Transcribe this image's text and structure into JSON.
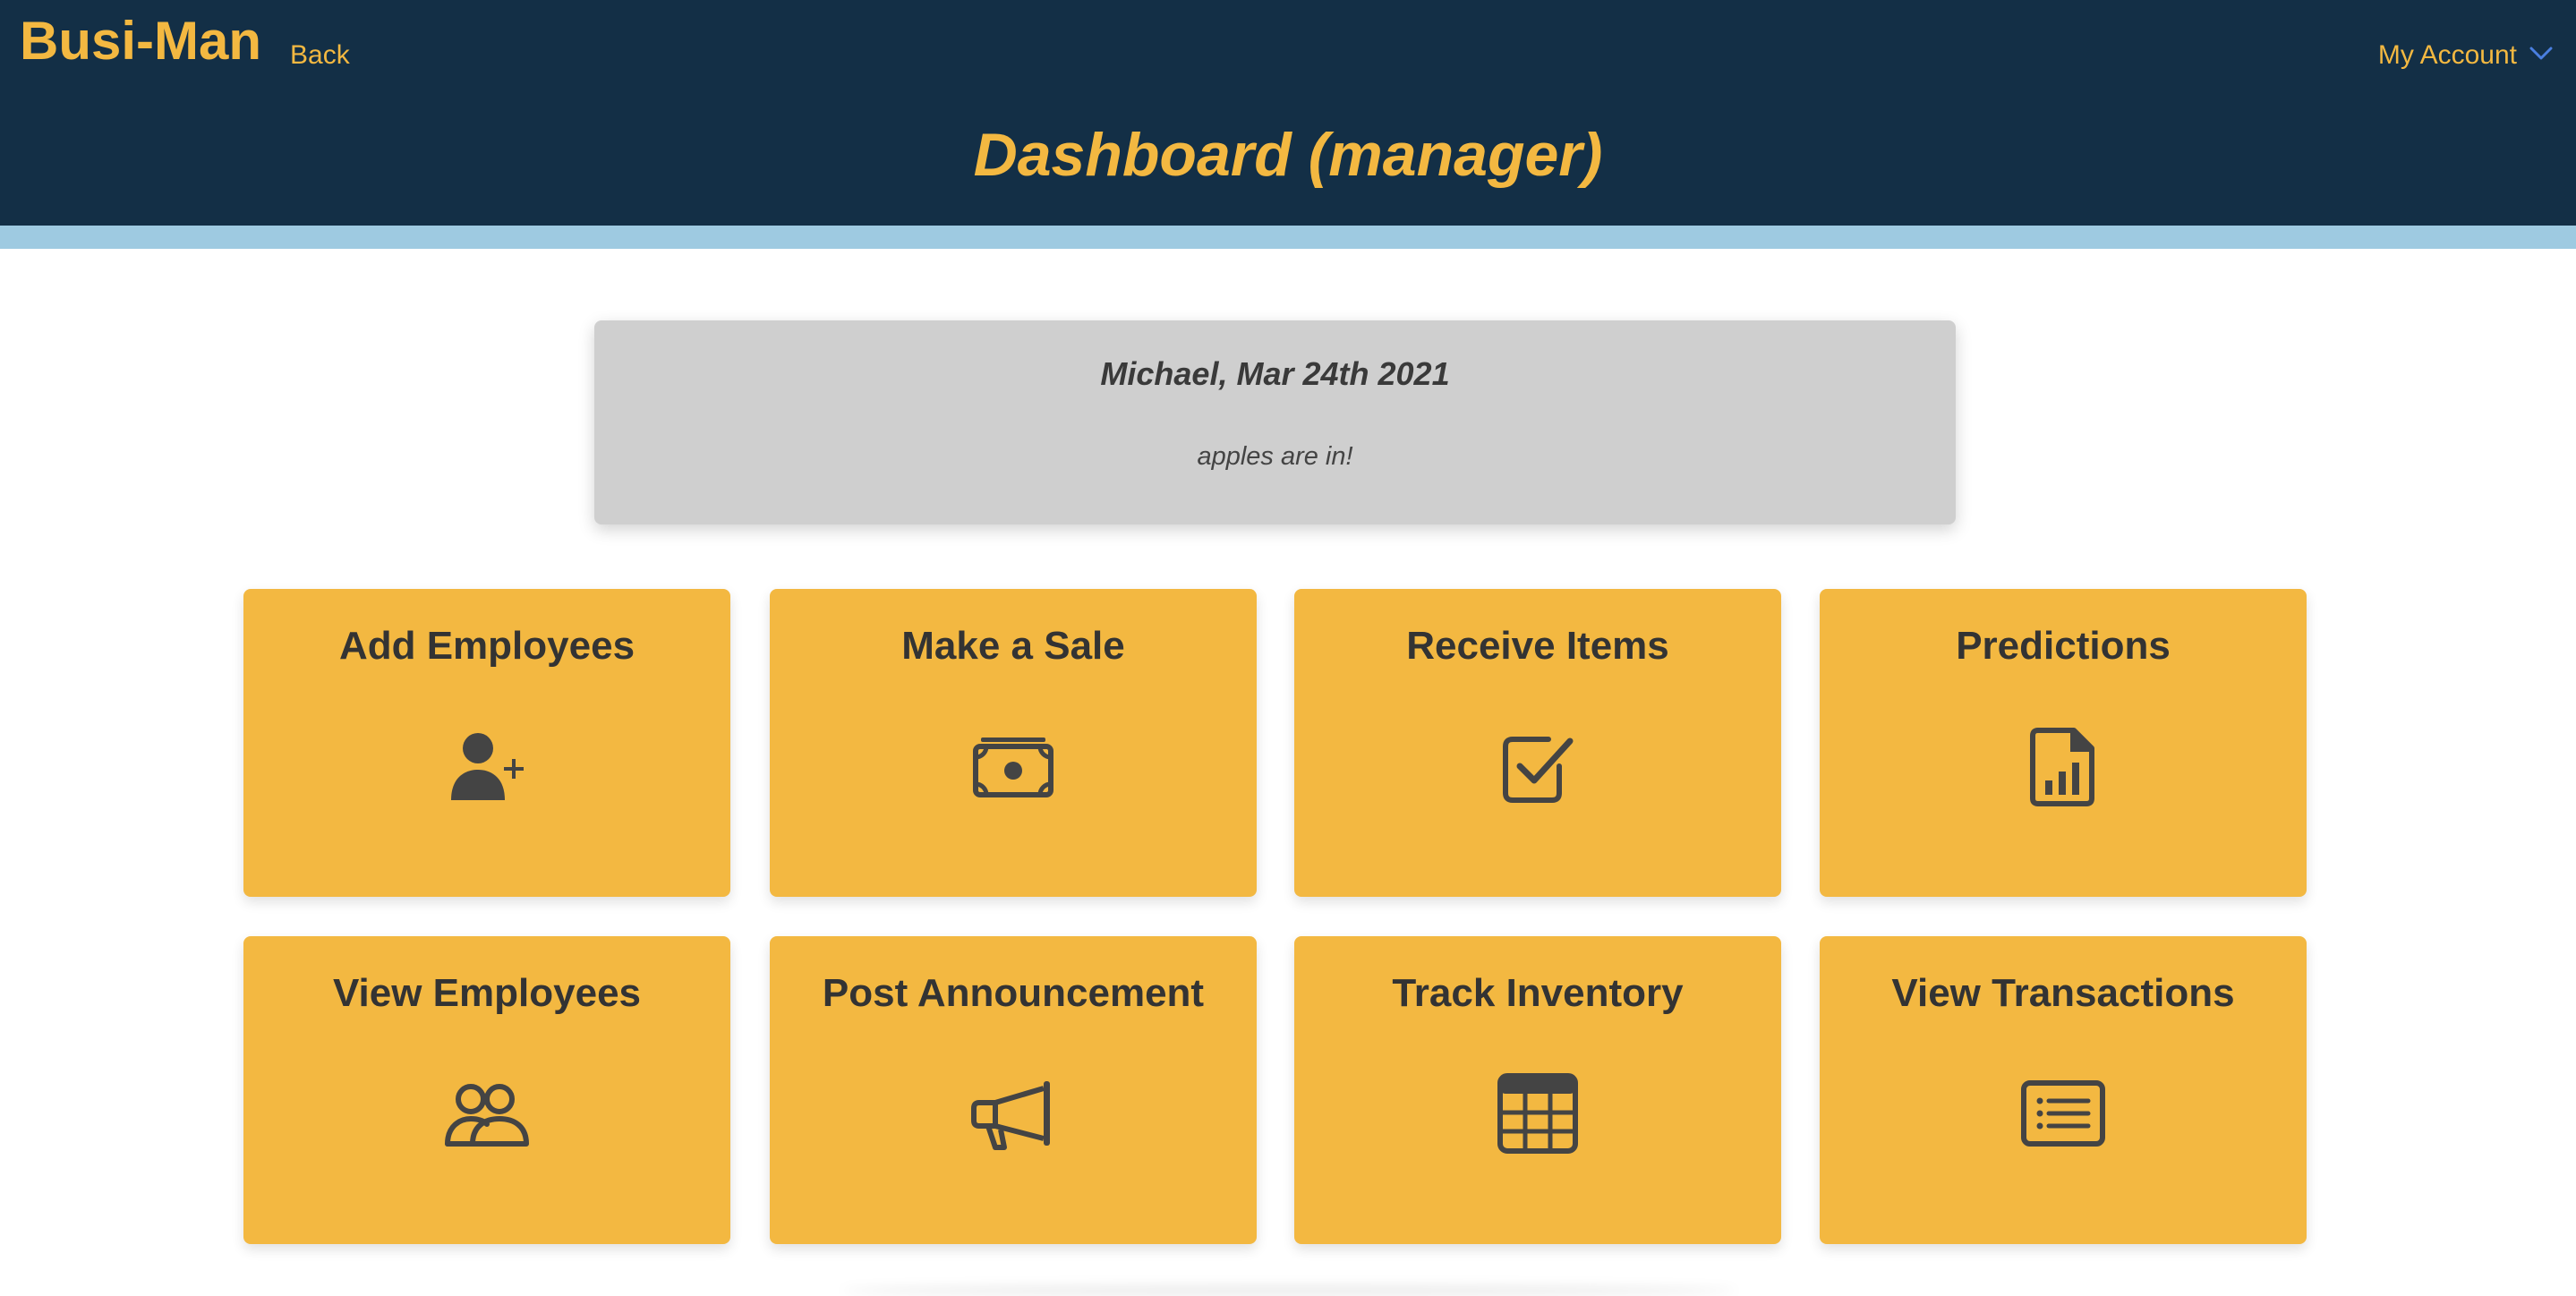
{
  "header": {
    "brand": "Busi-Man",
    "back_label": "Back",
    "account_label": "My Account",
    "account_icon": "chevron-down-icon",
    "page_title": "Dashboard (manager)"
  },
  "announcement": {
    "header": "Michael, Mar 24th 2021",
    "text": "apples are in!"
  },
  "tiles": [
    {
      "label": "Add Employees",
      "icon": "add-user-icon"
    },
    {
      "label": "Make a Sale",
      "icon": "money-bill-icon"
    },
    {
      "label": "Receive Items",
      "icon": "checkbox-icon"
    },
    {
      "label": "Predictions",
      "icon": "chart-file-icon"
    },
    {
      "label": "View Employees",
      "icon": "users-icon"
    },
    {
      "label": "Post Announcement",
      "icon": "megaphone-icon"
    },
    {
      "label": "Track Inventory",
      "icon": "table-icon"
    },
    {
      "label": "View Transactions",
      "icon": "list-icon"
    }
  ],
  "colors": {
    "header_bg": "#132f46",
    "stripe": "#9ecae1",
    "accent": "#f3b841",
    "announcement_bg": "#cfcfcf",
    "tile_text": "#333333",
    "chevron": "#4a7fe0"
  }
}
